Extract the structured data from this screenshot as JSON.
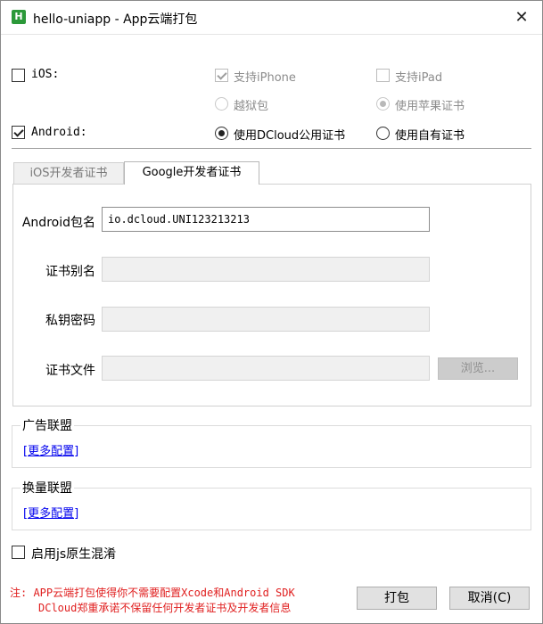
{
  "window": {
    "title": "hello-uniapp - App云端打包",
    "icon_letter": "H",
    "close_glyph": "✕"
  },
  "platforms": {
    "ios": {
      "label": "iOS:",
      "checked": false
    },
    "support_iphone": {
      "label": "支持iPhone",
      "checked": true,
      "enabled": false
    },
    "support_ipad": {
      "label": "支持iPad",
      "checked": false,
      "enabled": false
    },
    "jailbreak": {
      "label": "越狱包",
      "selected": false,
      "enabled": false
    },
    "apple_cert": {
      "label": "使用苹果证书",
      "selected": true,
      "enabled": false
    },
    "android": {
      "label": "Android:",
      "checked": true
    },
    "dcloud_cert": {
      "label": "使用DCloud公用证书",
      "selected": true
    },
    "own_cert": {
      "label": "使用自有证书",
      "selected": false
    }
  },
  "tabs": [
    {
      "label": "iOS开发者证书",
      "active": false
    },
    {
      "label": "Google开发者证书",
      "active": true
    }
  ],
  "form": {
    "package_label": "Android包名",
    "package_value": "io.dcloud.UNI123213213",
    "alias_label": "证书别名",
    "alias_value": "",
    "password_label": "私钥密码",
    "password_value": "",
    "file_label": "证书文件",
    "file_value": "",
    "browse_label": "浏览..."
  },
  "ad_union": {
    "title": "广告联盟",
    "link": "[更多配置]"
  },
  "exchange_union": {
    "title": "换量联盟",
    "link": "[更多配置]"
  },
  "obfuscate": {
    "label": "启用js原生混淆",
    "checked": false
  },
  "footer": {
    "note_line1": "注: APP云端打包使得你不需要配置Xcode和Android SDK",
    "note_line2": "DCloud郑重承诺不保留任何开发者证书及开发者信息",
    "pack_button": "打包",
    "cancel_button": "取消(C)"
  },
  "colors": {
    "note": "#e02020",
    "link": "#0000ee",
    "icon_bg": "#2b9939"
  }
}
